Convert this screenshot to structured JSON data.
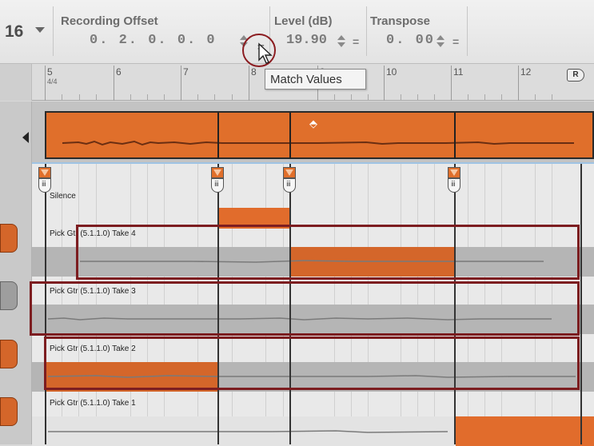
{
  "inspector": {
    "bar_number": "16",
    "recording_offset": {
      "label": "Recording Offset",
      "value": "0. 2. 0.   0. 0"
    },
    "level": {
      "label": "Level (dB)",
      "value": "19.90"
    },
    "transpose": {
      "label": "Transpose",
      "value": "0. 00"
    },
    "equals_symbol": "="
  },
  "tooltip": {
    "text": "Match Values"
  },
  "ruler": {
    "time_signature": "4/4",
    "bars": [
      "5",
      "6",
      "7",
      "8",
      "9",
      "10",
      "11",
      "12"
    ],
    "marker_label": "R"
  },
  "lanes": {
    "silence_label": "Silence",
    "takes": [
      {
        "label": "Pick Gtr (5.1.1.0) Take 4"
      },
      {
        "label": "Pick Gtr (5.1.1.0) Take 3"
      },
      {
        "label": "Pick Gtr (5.1.1.0) Take 2"
      },
      {
        "label": "Pick Gtr (5.1.1.0) Take 1"
      }
    ]
  },
  "colors": {
    "clip_orange": "#e06f2b",
    "selected_orange": "#d4662a",
    "callout_red": "#7c1d20",
    "lane_bg": "#e9e9e9"
  }
}
